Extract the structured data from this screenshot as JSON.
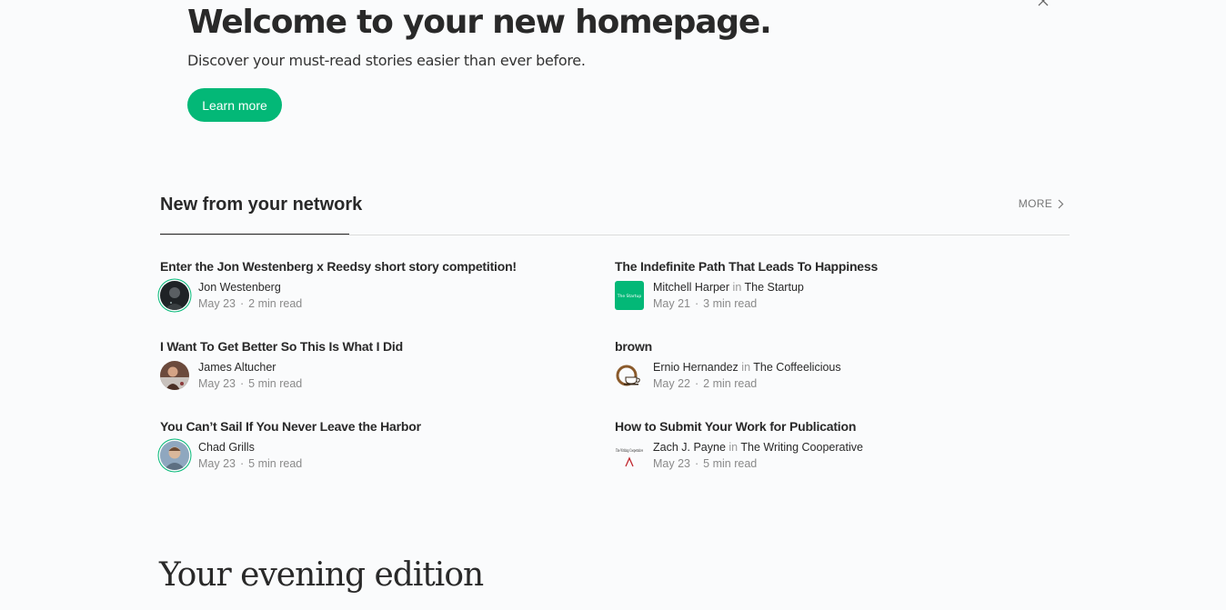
{
  "hero": {
    "title": "Welcome to your new homepage.",
    "subtitle": "Discover your must-read stories easier than ever before.",
    "button_label": "Learn more"
  },
  "network": {
    "title": "New from your network",
    "more_label": "MORE",
    "stories": [
      {
        "title": "Enter the Jon Westenberg x Reedsy short story competition!",
        "author": "Jon Westenberg",
        "in_label": "",
        "publication": "",
        "date": "May 23",
        "read_time": "2 min read",
        "avatar_icon": "author-avatar"
      },
      {
        "title": "The Indefinite Path That Leads To Happiness",
        "author": "Mitchell Harper",
        "in_label": "in",
        "publication": "The Startup",
        "date": "May 21",
        "read_time": "3 min read",
        "avatar_icon": "publication-logo",
        "logo_text": "The Startup"
      },
      {
        "title": "I Want To Get Better So This Is What I Did",
        "author": "James Altucher",
        "in_label": "",
        "publication": "",
        "date": "May 23",
        "read_time": "5 min read",
        "avatar_icon": "author-avatar"
      },
      {
        "title": "brown",
        "author": "Ernio Hernandez",
        "in_label": "in",
        "publication": "The Coffeelicious",
        "date": "May 22",
        "read_time": "2 min read",
        "avatar_icon": "coffee-cup-logo"
      },
      {
        "title": "You Can’t Sail If You Never Leave the Harbor",
        "author": "Chad Grills",
        "in_label": "",
        "publication": "",
        "date": "May 23",
        "read_time": "5 min read",
        "avatar_icon": "author-avatar"
      },
      {
        "title": "How to Submit Your Work for Publication",
        "author": "Zach J. Payne",
        "in_label": "in",
        "publication": "The Writing Cooperative",
        "date": "May 23",
        "read_time": "5 min read",
        "avatar_icon": "publication-logo",
        "logo_text": "The Writing Cooperative"
      }
    ]
  },
  "evening": {
    "title": "Your evening edition"
  },
  "colors": {
    "accent": "#03b877",
    "text": "#292929",
    "muted": "#8a8a8a",
    "background": "#fafbfc"
  },
  "icons": {
    "close": "close-icon",
    "more": "chevron-right-icon"
  }
}
